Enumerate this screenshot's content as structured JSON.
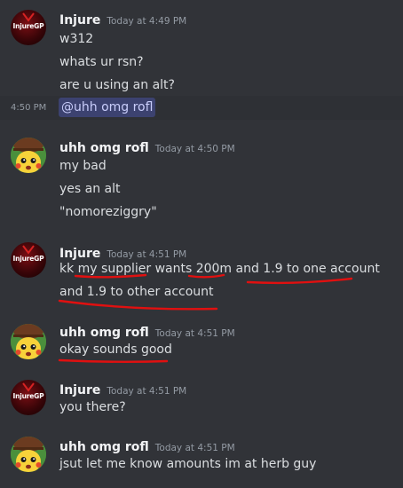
{
  "messages": [
    {
      "user": "Injure",
      "time": "Today at 4:49 PM",
      "avatar_text": "InjureGP",
      "lines": [
        "w312",
        "whats ur rsn?",
        "are u using an alt?"
      ]
    },
    {
      "hover_time": "4:50 PM",
      "mention": "@uhh omg rofl"
    },
    {
      "user": "uhh omg rofl",
      "time": "Today at 4:50 PM",
      "lines": [
        "my bad",
        "yes an alt",
        "\"nomoreziggry\""
      ]
    },
    {
      "user": "Injure",
      "time": "Today at 4:51 PM",
      "avatar_text": "InjureGP",
      "lines": [
        "kk my supplier wants 200m and 1.9 to one account",
        "and 1.9 to other account"
      ]
    },
    {
      "user": "uhh omg rofl",
      "time": "Today at 4:51 PM",
      "lines": [
        "okay sounds good"
      ]
    },
    {
      "user": "Injure",
      "time": "Today at 4:51 PM",
      "avatar_text": "InjureGP",
      "lines": [
        "you there?"
      ]
    },
    {
      "user": "uhh omg rofl",
      "time": "Today at 4:51 PM",
      "lines": [
        "jsut let me know amounts im at herb guy"
      ]
    }
  ],
  "colors": {
    "background": "#313338",
    "annotation": "#e01010",
    "mention_bg": "#3c4270"
  },
  "icons": [
    "injuregp-avatar",
    "pikachu-avatar"
  ]
}
